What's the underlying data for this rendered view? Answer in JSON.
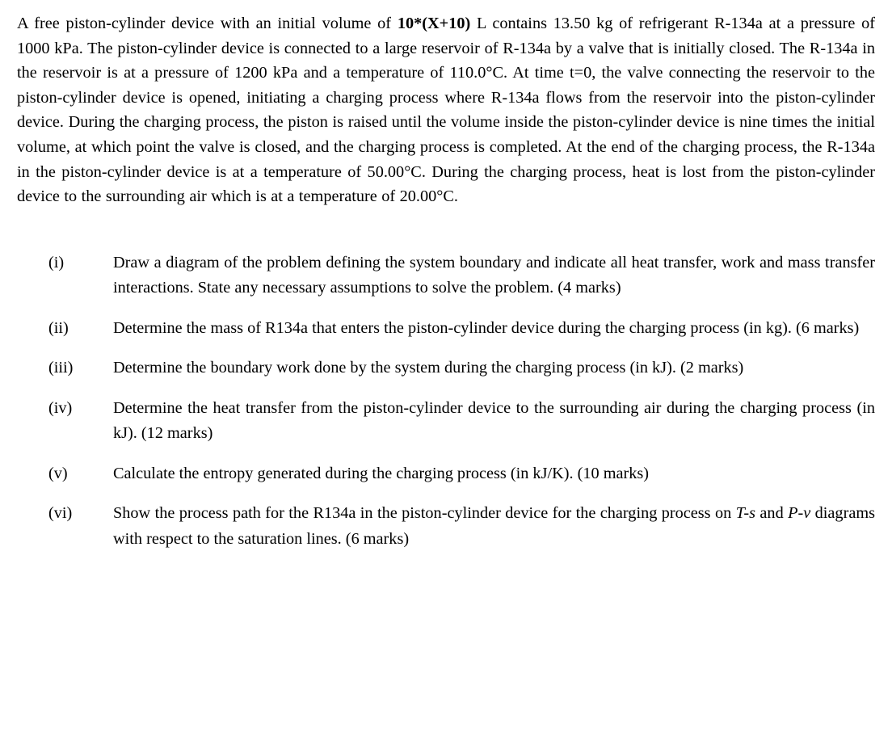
{
  "document": {
    "intro": {
      "part1": "A free piston-cylinder device with an initial volume of ",
      "bold_variable": "10*(X+10)",
      "part2": " L contains 13.50 kg of refrigerant R-134a at a pressure of 1000 kPa. The piston-cylinder device is connected to a large reservoir of R-134a by a valve that is initially closed. The R-134a in the reservoir is at a pressure of 1200 kPa and a temperature of 110.0°C. At time t=0, the valve connecting the reservoir to the piston-cylinder device is opened, initiating a charging process where R-134a flows from the reservoir into the piston-cylinder device. During the charging process, the piston is raised until the volume inside the piston-cylinder device is nine times the initial volume, at which point the valve is closed, and the charging process is completed. At the end of the charging process, the R-134a in the piston-cylinder device is at a temperature of 50.00°C. During the charging process, heat is lost from the piston-cylinder device to the surrounding air which is at a temperature of 20.00°C."
    },
    "questions": [
      {
        "number": "(i)",
        "text": "Draw a diagram of the problem defining the system boundary and indicate all heat transfer, work and mass transfer interactions. State any necessary assumptions to solve the problem. (4 marks)",
        "marks": "4 marks"
      },
      {
        "number": "(ii)",
        "text": "Determine the mass of R134a that enters the piston-cylinder device during the charging process (in kg). (6 marks)",
        "marks": "6 marks"
      },
      {
        "number": "(iii)",
        "text": "Determine the boundary work done by the system during the charging process (in kJ). (2 marks)",
        "marks": "2 marks"
      },
      {
        "number": "(iv)",
        "text": "Determine the heat transfer from the piston-cylinder device to the surrounding air during the charging process (in kJ). (12 marks)",
        "marks": "12 marks"
      },
      {
        "number": "(v)",
        "text": "Calculate the entropy generated during the charging process (in kJ/K). (10 marks)",
        "marks": "10 marks"
      },
      {
        "number": "(vi)",
        "text_before_ts": "Show the process path for the R134a in the piston-cylinder device for the charging process on ",
        "italic_ts": "T-s",
        "text_between": " and ",
        "italic_pv": "P-v",
        "text_after": " diagrams with respect to the saturation lines. (6 marks)",
        "marks": "6 marks"
      }
    ]
  }
}
